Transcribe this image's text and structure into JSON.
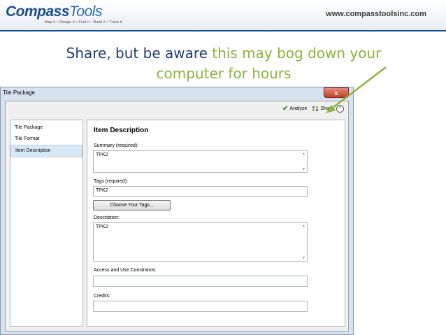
{
  "header": {
    "logo_main": "Compass",
    "logo_accent": "Tools",
    "tagline": "Map it • Design it • Find it • Build it • Track it",
    "url": "www.compasstoolsinc.com"
  },
  "slide": {
    "title_part1": "Share, but be aware ",
    "title_part2": "this may bog down your",
    "title_part3": "computer for hours"
  },
  "window": {
    "title": "Tile Package",
    "close_label": "x",
    "toolbar": {
      "analyze_label": "Analyze",
      "share_label": "Share"
    },
    "sidebar": {
      "items": [
        "Tile Package",
        "Tile Format",
        "Item Description"
      ]
    },
    "form": {
      "section_title": "Item Description",
      "summary_label": "Summary (required):",
      "summary_value": "TPK2",
      "tags_label": "Tags (required):",
      "tags_value": "TPK2",
      "choose_tags_label": "Choose Your Tags...",
      "description_label": "Description:",
      "description_value": "TPK2",
      "access_label": "Access and Use Constraints:",
      "access_value": "",
      "credits_label": "Credits:",
      "credits_value": ""
    }
  },
  "colors": {
    "accent_green": "#8ab53b",
    "title_blue": "#1f3b73",
    "brand_blue": "#1b4e8f"
  }
}
